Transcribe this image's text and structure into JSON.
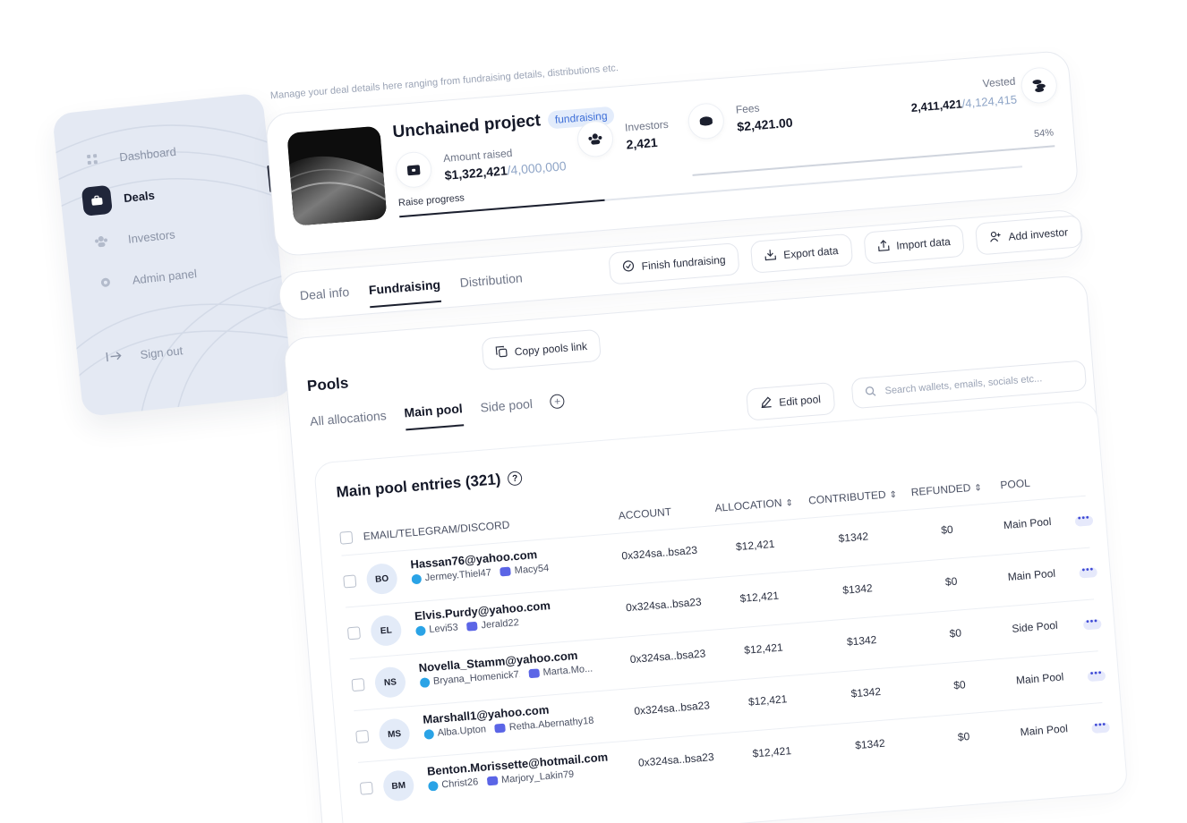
{
  "sidebar": {
    "items": [
      {
        "label": "Dashboard",
        "icon": "grid-icon",
        "active": false
      },
      {
        "label": "Deals",
        "icon": "briefcase-icon",
        "active": true
      },
      {
        "label": "Investors",
        "icon": "users-icon",
        "active": false
      },
      {
        "label": "Admin panel",
        "icon": "gear-icon",
        "active": false
      }
    ],
    "sign_out": "Sign out"
  },
  "page": {
    "subtitle": "Manage your deal details here ranging from fundraising details, distributions etc."
  },
  "deal": {
    "title": "Unchained project",
    "status": "fundraising",
    "amount_raised_label": "Amount raised",
    "amount_raised": "$1,322,421",
    "amount_target": "/4,000,000",
    "investors_label": "Investors",
    "investors": "2,421",
    "fees_label": "Fees",
    "fees": "$2,421.00",
    "vested_label": "Vested",
    "vested": "2,411,421",
    "vested_total": "/4,124,415",
    "vested_pct": "54%",
    "raise_label": "Raise progress",
    "raise_progress": 0.33
  },
  "deal_tabs": [
    "Deal info",
    "Fundraising",
    "Distribution"
  ],
  "actions": {
    "finish": "Finish fundraising",
    "export": "Export data",
    "import": "Import data",
    "add": "Add investor",
    "copy": "Copy pools link"
  },
  "pools": {
    "title": "Pools",
    "tabs": [
      "All allocations",
      "Main pool",
      "Side pool"
    ],
    "edit": "Edit pool",
    "search_placeholder": "Search wallets, emails, socials etc..."
  },
  "entries": {
    "title": "Main pool entries (321)",
    "columns": {
      "email": "EMAIL/TELEGRAM/DISCORD",
      "account": "ACCOUNT",
      "allocation": "ALLOCATION",
      "contributed": "CONTRIBUTED",
      "refunded": "REFUNDED",
      "pool": "POOL"
    },
    "rows": [
      {
        "initials": "BO",
        "email": "Hassan76@yahoo.com",
        "telegram": "Jermey.Thiel47",
        "discord": "Macy54",
        "account": "0x324sa..bsa23",
        "allocation": "$12,421",
        "contributed": "$1342",
        "refunded": "$0",
        "pool": "Main Pool"
      },
      {
        "initials": "EL",
        "email": "Elvis.Purdy@yahoo.com",
        "telegram": "Levi53",
        "discord": "Jerald22",
        "account": "0x324sa..bsa23",
        "allocation": "$12,421",
        "contributed": "$1342",
        "refunded": "$0",
        "pool": "Main Pool"
      },
      {
        "initials": "NS",
        "email": "Novella_Stamm@yahoo.com",
        "telegram": "Bryana_Homenick71",
        "discord": "Marta.Mo...",
        "account": "0x324sa..bsa23",
        "allocation": "$12,421",
        "contributed": "$1342",
        "refunded": "$0",
        "pool": "Side Pool"
      },
      {
        "initials": "MS",
        "email": "Marshall1@yahoo.com",
        "telegram": "Alba.Upton",
        "discord": "Retha.Abernathy18",
        "account": "0x324sa..bsa23",
        "allocation": "$12,421",
        "contributed": "$1342",
        "refunded": "$0",
        "pool": "Main Pool"
      },
      {
        "initials": "BM",
        "email": "Benton.Morissette@hotmail.com",
        "telegram": "Christ26",
        "discord": "Marjory_Lakin79",
        "account": "0x324sa..bsa23",
        "allocation": "$12,421",
        "contributed": "$1342",
        "refunded": "$0",
        "pool": "Main Pool"
      }
    ]
  }
}
